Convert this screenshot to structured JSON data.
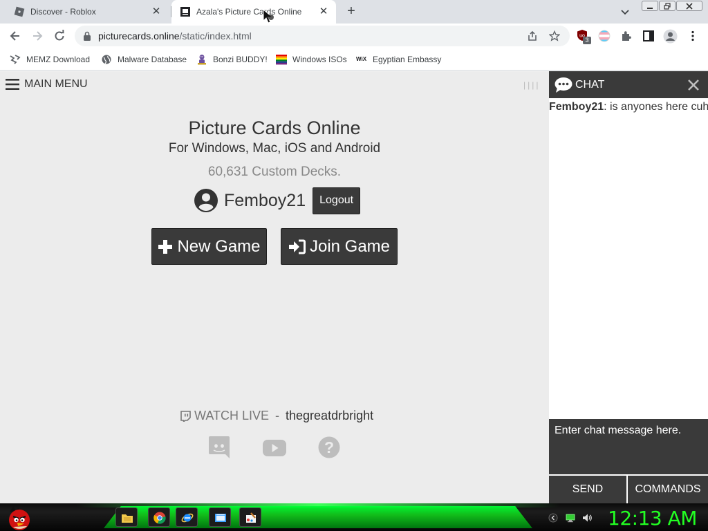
{
  "browser": {
    "tabs": [
      {
        "title": "Discover - Roblox",
        "active": false
      },
      {
        "title": "Azala's Picture Cards Online",
        "active": true
      }
    ],
    "url_host": "picturecards.online",
    "url_path": "/static/index.html",
    "extension_badge": "3",
    "bookmarks": [
      {
        "label": "MEMZ Download",
        "icon": "zigzag-icon"
      },
      {
        "label": "Malware Database",
        "icon": "globe-icon"
      },
      {
        "label": "Bonzi BUDDY!",
        "icon": "gorilla-icon"
      },
      {
        "label": "Windows ISOs",
        "icon": "rainbow-flag-icon"
      },
      {
        "label": "Egyptian Embassy",
        "icon": "wix-icon"
      }
    ],
    "bookmark_icon_text": "WiX"
  },
  "page": {
    "menu_label": "MAIN MENU",
    "title": "Picture Cards Online",
    "subtitle": "For Windows, Mac, iOS and Android",
    "decks": "60,631 Custom Decks.",
    "username": "Femboy21",
    "logout_label": "Logout",
    "new_game_label": "New Game",
    "join_game_label": "Join Game",
    "watch_live_label": "WATCH LIVE",
    "watch_separator": "-",
    "channel": "thegreatdrbright",
    "social_icons": [
      "discord-icon",
      "youtube-icon",
      "help-icon"
    ]
  },
  "chat": {
    "title": "CHAT",
    "messages": [
      {
        "user": "Femboy21",
        "text": ": is anyones here cuh"
      }
    ],
    "input_placeholder": "Enter chat message here.",
    "send_label": "SEND",
    "commands_label": "COMMANDS"
  },
  "taskbar": {
    "clock": "12:13 AM",
    "apps": [
      "file-explorer-icon",
      "chrome-icon",
      "internet-explorer-icon",
      "window-app-icon",
      "paint-icon"
    ]
  },
  "colors": {
    "dark_button": "#3a3a3a",
    "page_bg": "#ececec",
    "clock_green": "#22ff22",
    "taskbar_green": "#11c51a"
  }
}
